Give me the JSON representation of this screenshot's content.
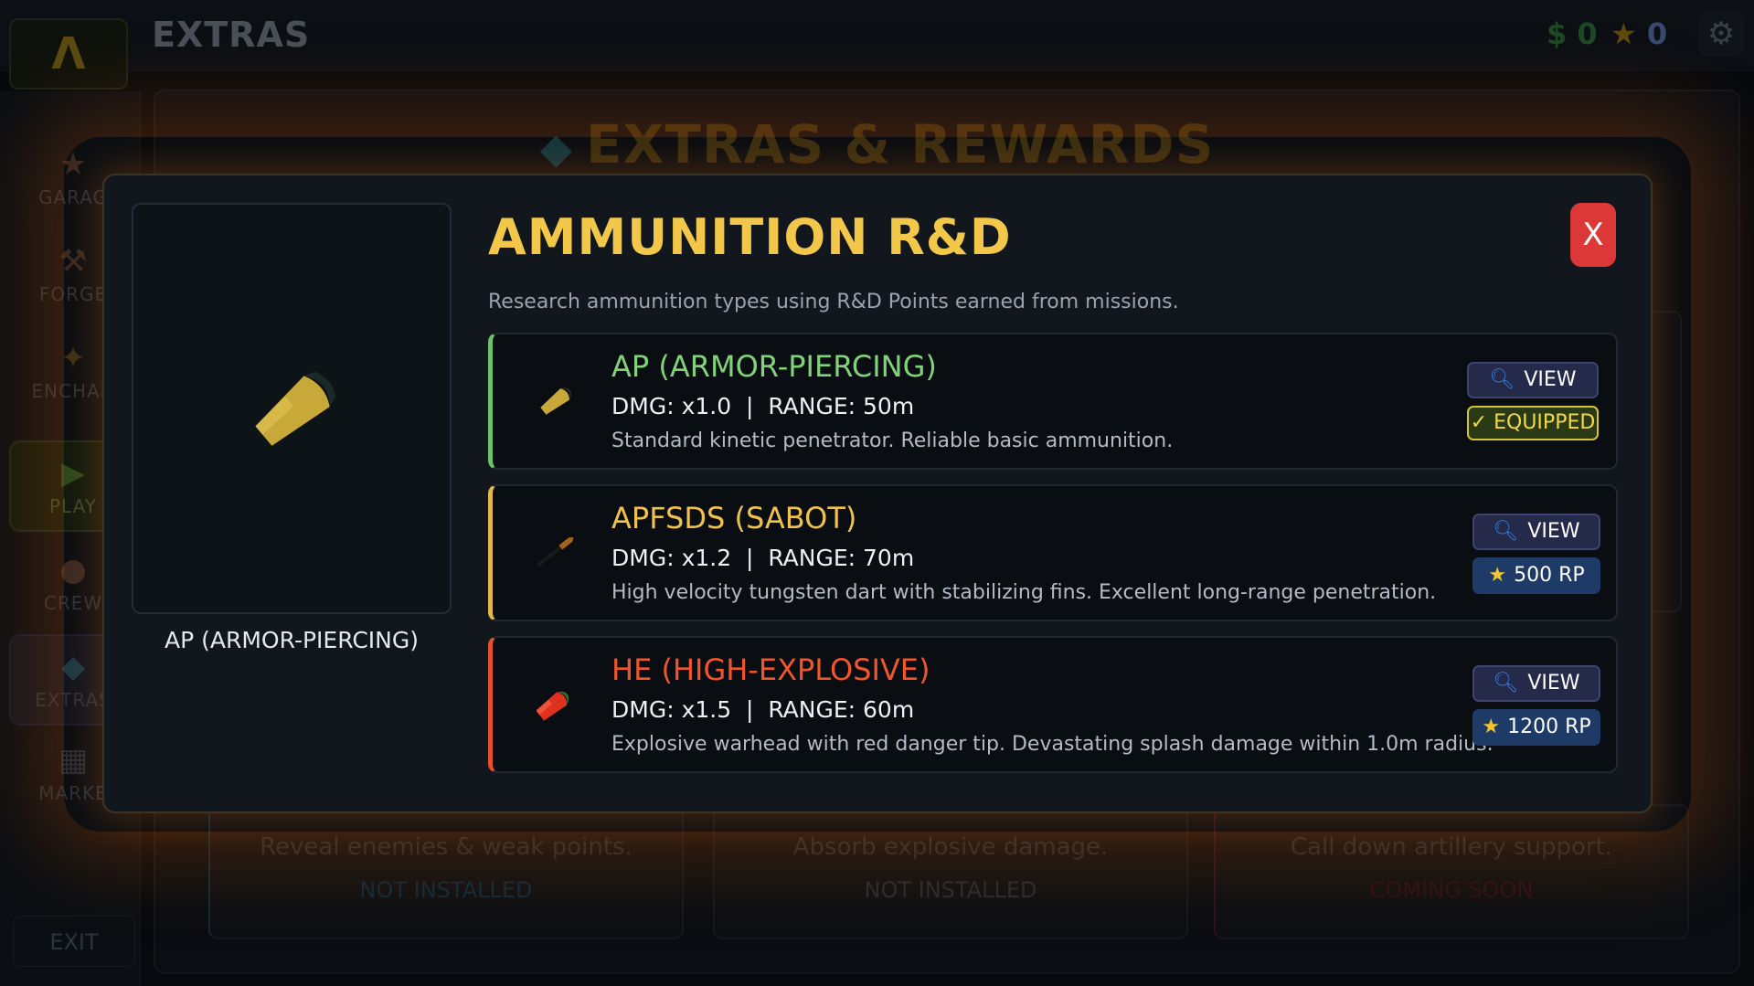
{
  "header": {
    "logo_glyph": "Λ",
    "title": "EXTRAS",
    "money": "$ 0",
    "stars": "0",
    "settings_icon": "gear-icon"
  },
  "sidebar": {
    "items": [
      {
        "label": "GARAG",
        "icon": "star-icon"
      },
      {
        "label": "FORGE",
        "icon": "hammer-icon"
      },
      {
        "label": "ENCHAN",
        "icon": "sparkle-icon"
      },
      {
        "label": "PLAY",
        "icon": "play-icon"
      },
      {
        "label": "CREW",
        "icon": "person-icon"
      },
      {
        "label": "EXTRAS",
        "icon": "gem-icon"
      },
      {
        "label": "MARKE",
        "icon": "cart-icon"
      }
    ],
    "exit_label": "EXIT"
  },
  "background": {
    "heading": "EXTRAS & REWARDS",
    "cards": [
      {
        "desc": "Reveal enemies & weak points.",
        "status": "NOT INSTALLED"
      },
      {
        "desc": "Absorb explosive damage.",
        "status": "NOT INSTALLED"
      },
      {
        "desc": "Call down artillery support.",
        "status": "COMING SOON"
      }
    ]
  },
  "modal": {
    "title": "AMMUNITION R&D",
    "subtitle": "Research ammunition types using R&D Points earned from missions.",
    "close_label": "X",
    "preview_caption": "AP (ARMOR-PIERCING)",
    "ammo": [
      {
        "name": "AP (ARMOR-PIERCING)",
        "stats": "DMG: x1.0  |  RANGE: 50m",
        "desc": "Standard kinetic penetrator. Reliable basic ammunition.",
        "view_label": "VIEW",
        "action_label": "✓ EQUIPPED",
        "accent": "#6bc26a"
      },
      {
        "name": "APFSDS (SABOT)",
        "stats": "DMG: x1.2  |  RANGE: 70m",
        "desc": "High velocity tungsten dart with stabilizing fins. Excellent long-range penetration.",
        "view_label": "VIEW",
        "action_label": "500 RP",
        "accent": "#e2b84a"
      },
      {
        "name": "HE (HIGH-EXPLOSIVE)",
        "stats": "DMG: x1.5  |  RANGE: 60m",
        "desc": "Explosive warhead with red danger tip. Devastating splash damage within 1.0m radius.",
        "view_label": "VIEW",
        "action_label": "1200 RP",
        "accent": "#e2502c"
      }
    ]
  }
}
